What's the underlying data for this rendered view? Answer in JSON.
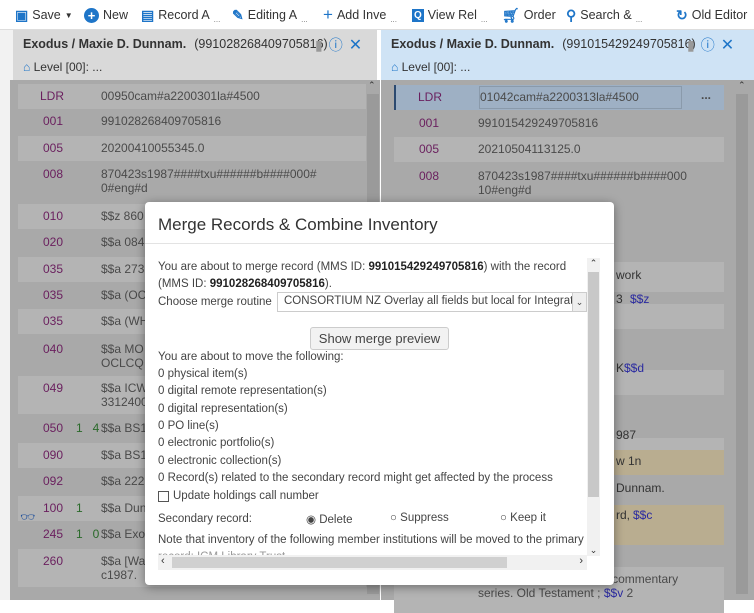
{
  "toolbar": {
    "items": [
      {
        "label": "Save",
        "icon": "save-icon"
      },
      {
        "label": "New",
        "icon": "plus-circle-icon"
      },
      {
        "label": "Record A",
        "icon": "record-icon"
      },
      {
        "label": "Editing A",
        "icon": "pencil-icon"
      },
      {
        "label": "Add Inve",
        "icon": "plus-icon"
      },
      {
        "label": "View Rel",
        "icon": "view-icon"
      },
      {
        "label": "Order",
        "icon": "cart-icon"
      },
      {
        "label": "Search &",
        "icon": "search-icon"
      },
      {
        "label": "Old Editor",
        "icon": "refresh-icon"
      }
    ],
    "ellipsis": "..."
  },
  "left_panel": {
    "title": "Exodus / Maxie D. Dunnam.",
    "mms_id": "(991028268409705816)",
    "level": "Level [00]: ...",
    "rows": [
      {
        "tag": "LDR",
        "ind": "",
        "val": "00950cam#a2200301la#4500"
      },
      {
        "tag": "001",
        "ind": "",
        "val": "991028268409705816"
      },
      {
        "tag": "005",
        "ind": "",
        "val": "20200410055345.0"
      },
      {
        "tag": "008",
        "ind": "",
        "val": "870423s1987####txu######b####000#",
        "val2": "0#eng#d"
      },
      {
        "tag": "010",
        "ind": "",
        "val": "$$z 860"
      },
      {
        "tag": "020",
        "ind": "",
        "val": "$$a 084"
      },
      {
        "tag": "035",
        "ind": "",
        "val": "$$a 273"
      },
      {
        "tag": "035",
        "ind": "",
        "val": "$$a (OC"
      },
      {
        "tag": "035",
        "ind": "",
        "val": "$$a (WH"
      },
      {
        "tag": "040",
        "ind": "",
        "val": "$$a MO",
        "val2": "OCLCQ"
      },
      {
        "tag": "049",
        "ind": "",
        "val": "$$a ICW",
        "val2": "3312400"
      },
      {
        "tag": "050",
        "ind": "1   4",
        "val": "$$a BS1"
      },
      {
        "tag": "090",
        "ind": "",
        "val": "$$a BS1"
      },
      {
        "tag": "092",
        "ind": "",
        "val": "$$a 222"
      },
      {
        "tag": "100",
        "ind": "1",
        "val": "$$a Dun"
      },
      {
        "tag": "245",
        "ind": "1   0",
        "val": "$$a Exo"
      },
      {
        "tag": "260",
        "ind": "",
        "val": "$$a [Wa",
        "val2": "c1987."
      }
    ]
  },
  "right_panel": {
    "title": "Exodus / Maxie D. Dunnam.",
    "mms_id": "(991015429249705816)",
    "level": "Level [00]: ...",
    "more": "...",
    "rows": [
      {
        "tag": "LDR",
        "val": "01042cam#a2200313la#4500"
      },
      {
        "tag": "001",
        "val": "991015429249705816"
      },
      {
        "tag": "005",
        "val": "20210504113125.0"
      },
      {
        "tag": "008",
        "val": "870423s1987####txu######b####000",
        "val2": "10#eng#d"
      }
    ],
    "fragments": [
      "work",
      "3",
      "$$z",
      "K",
      "$$d",
      "987",
      "w 1n",
      "Dunnam.",
      "rd,",
      "$$c"
    ],
    "bottom_row": {
      "val": "$$a The communicator's commentary",
      "val2": "series. Old Testament ;",
      "sub": "$$v",
      "tail": "2"
    }
  },
  "modal": {
    "title": "Merge Records & Combine Inventory",
    "intro_1": "You are about to merge record (MMS ID: ",
    "secondary_id": "991015429249705816",
    "intro_2": ") with the record",
    "intro_3": "(MMS ID: ",
    "primary_id": "991028268409705816",
    "intro_4": ").",
    "routine_label": "Choose merge routine",
    "routine_value": "CONSORTIUM NZ Overlay all fields but local for Integrati",
    "preview_button": "Show merge preview",
    "move_heading": "You are about to move the following:",
    "move_items": [
      "0 physical item(s)",
      "0 digital remote representation(s)",
      "0 digital representation(s)",
      "0 PO line(s)",
      "0 electronic portfolio(s)",
      "0 electronic collection(s)",
      "0 Record(s) related to the secondary record might get affected by the process"
    ],
    "update_holdings": "Update holdings call number",
    "update_holdings_checked": false,
    "secondary_label": "Secondary record:",
    "secondary_options": [
      "Delete",
      "Suppress",
      "Keep it"
    ],
    "secondary_selected": "Delete",
    "note": "Note that inventory of the following member institutions will be moved to the primary",
    "note_2": "record: ICM Library Trust"
  }
}
